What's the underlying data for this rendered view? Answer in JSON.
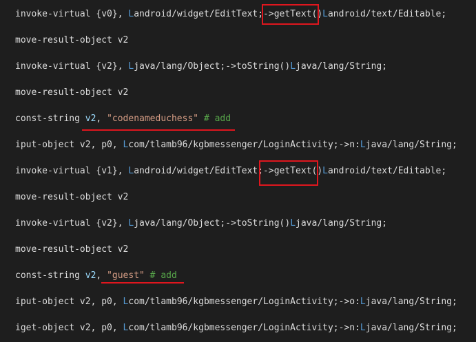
{
  "code_lines": [
    {
      "tokens": [
        {
          "t": "invoke-virtual {v0}, ",
          "c": "plain"
        },
        {
          "t": "L",
          "c": "type"
        },
        {
          "t": "android/widget/EditText;",
          "c": "plain"
        },
        {
          "t": "->",
          "c": "plain"
        },
        {
          "t": "getText()",
          "c": "plain"
        },
        {
          "t": "L",
          "c": "type"
        },
        {
          "t": "android/text/Editable;",
          "c": "plain"
        }
      ]
    },
    {
      "tokens": [
        {
          "t": "move-result-object v2",
          "c": "plain"
        }
      ]
    },
    {
      "tokens": [
        {
          "t": "invoke-virtual {v2}, ",
          "c": "plain"
        },
        {
          "t": "L",
          "c": "type"
        },
        {
          "t": "java/lang/Object;->toString()",
          "c": "plain"
        },
        {
          "t": "L",
          "c": "type"
        },
        {
          "t": "java/lang/String;",
          "c": "plain"
        }
      ]
    },
    {
      "tokens": [
        {
          "t": "move-result-object v2",
          "c": "plain"
        }
      ]
    },
    {
      "tokens": [
        {
          "t": "const-string ",
          "c": "plain"
        },
        {
          "t": "v2",
          "c": "reg"
        },
        {
          "t": ", ",
          "c": "plain"
        },
        {
          "t": "\"codenameduchess\"",
          "c": "str"
        },
        {
          "t": " # add",
          "c": "cmt"
        }
      ]
    },
    {
      "tokens": [
        {
          "t": "iput-object v2, p0, ",
          "c": "plain"
        },
        {
          "t": "L",
          "c": "type"
        },
        {
          "t": "com/tlamb96/kgbmessenger/LoginActivity;->n:",
          "c": "plain"
        },
        {
          "t": "L",
          "c": "type"
        },
        {
          "t": "java/lang/String;",
          "c": "plain"
        }
      ]
    },
    {
      "tokens": [
        {
          "t": "invoke-virtual {v1}, ",
          "c": "plain"
        },
        {
          "t": "L",
          "c": "type"
        },
        {
          "t": "android/widget/EditText;",
          "c": "plain"
        },
        {
          "t": "->",
          "c": "plain"
        },
        {
          "t": "getText()",
          "c": "plain"
        },
        {
          "t": "L",
          "c": "type"
        },
        {
          "t": "android/text/Editable;",
          "c": "plain"
        }
      ]
    },
    {
      "tokens": [
        {
          "t": "move-result-object v2",
          "c": "plain"
        }
      ]
    },
    {
      "tokens": [
        {
          "t": "invoke-virtual {v2}, ",
          "c": "plain"
        },
        {
          "t": "L",
          "c": "type"
        },
        {
          "t": "java/lang/Object;->toString()",
          "c": "plain"
        },
        {
          "t": "L",
          "c": "type"
        },
        {
          "t": "java/lang/String;",
          "c": "plain"
        }
      ]
    },
    {
      "tokens": [
        {
          "t": "move-result-object v2",
          "c": "plain"
        }
      ]
    },
    {
      "tokens": [
        {
          "t": "const-string ",
          "c": "plain"
        },
        {
          "t": "v2",
          "c": "reg"
        },
        {
          "t": ", ",
          "c": "plain"
        },
        {
          "t": "\"guest\"",
          "c": "str"
        },
        {
          "t": " # add",
          "c": "cmt"
        }
      ]
    },
    {
      "tokens": [
        {
          "t": "iput-object v2, p0, ",
          "c": "plain"
        },
        {
          "t": "L",
          "c": "type"
        },
        {
          "t": "com/tlamb96/kgbmessenger/LoginActivity;->o:",
          "c": "plain"
        },
        {
          "t": "L",
          "c": "type"
        },
        {
          "t": "java/lang/String;",
          "c": "plain"
        }
      ]
    },
    {
      "tokens": [
        {
          "t": "iget-object v2, p0, ",
          "c": "plain"
        },
        {
          "t": "L",
          "c": "type"
        },
        {
          "t": "com/tlamb96/kgbmessenger/LoginActivity;->n:",
          "c": "plain"
        },
        {
          "t": "L",
          "c": "type"
        },
        {
          "t": "java/lang/String;",
          "c": "plain"
        }
      ]
    }
  ],
  "colors": {
    "background": "#1e1e1e",
    "text": "#dcdcdc",
    "type_prefix": "#569cd6",
    "register": "#9cdcfe",
    "string": "#d69d85",
    "comment": "#57a64a",
    "annotation": "#e0161e"
  }
}
